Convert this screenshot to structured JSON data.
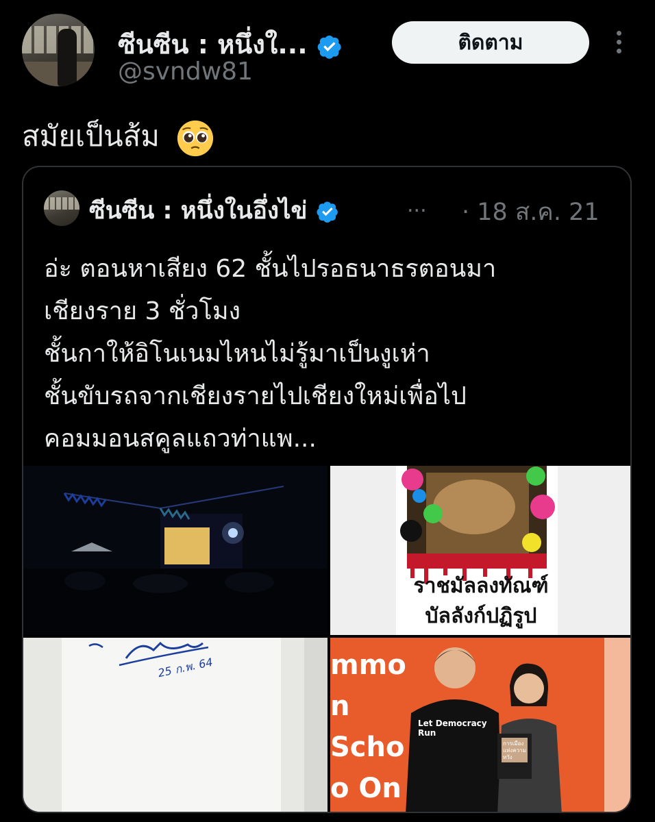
{
  "author": {
    "display_name": "ซีนซีน : หนึ่งใ...",
    "handle": "@svndw81",
    "verified": true
  },
  "follow_button": {
    "label": "ติดตาม"
  },
  "more_icon": "more-vertical-icon",
  "tweet": {
    "text": "สมัยเป็นส้ม",
    "emoji": "pleading-face"
  },
  "quoted_tweet": {
    "display_name": "ซีนซีน : หนึ่งในอึ่งไข่",
    "ellipsis": "...",
    "date": "· 18 ส.ค. 21",
    "lines": [
      "อ่ะ ตอนหาเสียง 62 ชั้นไปรอธนาธรตอนมา",
      "เชียงราย 3 ชั่วโมง",
      "ชั้นกาให้อิโนเนมไหนไม่รู้มาเป็นงูเห่า",
      "ชั้นขับรถจากเชียงรายไปเชียงใหม่เพื่อไป",
      "คอมมอนสคูลแถวท่าแพ..."
    ]
  },
  "media": {
    "photo2": {
      "title_line1": "ราชมัลลงทัณฑ์",
      "title_line2": "บัลลังก์ปฏิรูป"
    },
    "photo3": {
      "signature_text": "25 ก.พ. 64"
    },
    "photo4": {
      "backdrop_text": "mmon Schoo On",
      "shirt_text": "Let Democracy Run",
      "book_text": "การเมืองแห่งความหวัง"
    }
  },
  "colors": {
    "background": "#000000",
    "text_primary": "#e7e9ea",
    "text_secondary": "#71767b",
    "verified_blue": "#1d9bf0",
    "follow_button_bg": "#eff3f4",
    "card_border": "#2f3336"
  }
}
